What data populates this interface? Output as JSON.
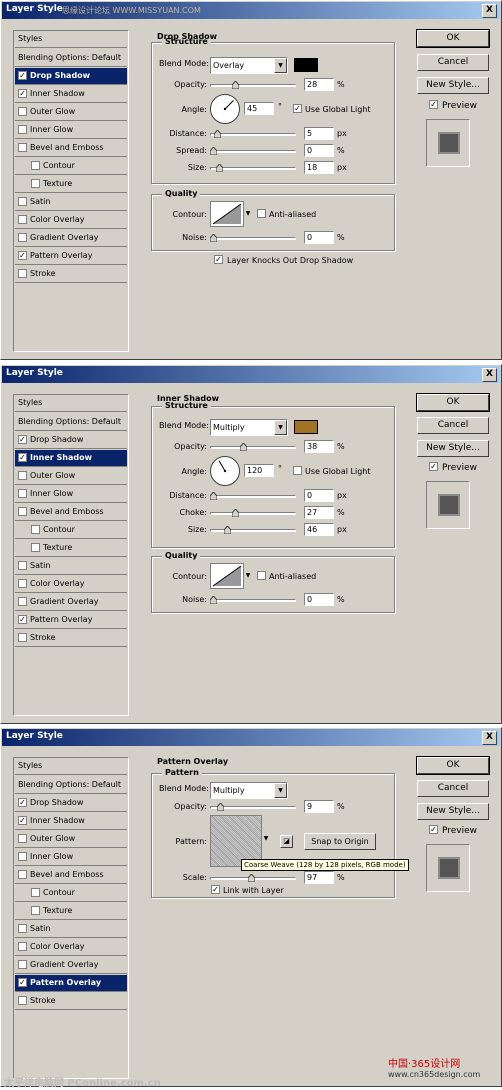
{
  "dialog_title": "Layer Style",
  "close_glyph": "X",
  "buttons": {
    "ok": "OK",
    "cancel": "Cancel",
    "new_style": "New Style...",
    "preview": "Preview"
  },
  "styles_list": [
    {
      "label": "Styles",
      "checkbox": false,
      "indent": false
    },
    {
      "label": "Blending Options: Default",
      "checkbox": false,
      "indent": false
    },
    {
      "label": "Drop Shadow",
      "checkbox": true,
      "indent": false
    },
    {
      "label": "Inner Shadow",
      "checkbox": true,
      "indent": false
    },
    {
      "label": "Outer Glow",
      "checkbox": true,
      "indent": false
    },
    {
      "label": "Inner Glow",
      "checkbox": true,
      "indent": false
    },
    {
      "label": "Bevel and Emboss",
      "checkbox": true,
      "indent": false
    },
    {
      "label": "Contour",
      "checkbox": true,
      "indent": true
    },
    {
      "label": "Texture",
      "checkbox": true,
      "indent": true
    },
    {
      "label": "Satin",
      "checkbox": true,
      "indent": false
    },
    {
      "label": "Color Overlay",
      "checkbox": true,
      "indent": false
    },
    {
      "label": "Gradient Overlay",
      "checkbox": true,
      "indent": false
    },
    {
      "label": "Pattern Overlay",
      "checkbox": true,
      "indent": false
    },
    {
      "label": "Stroke",
      "checkbox": true,
      "indent": false
    }
  ],
  "checked_styles": [
    "Drop Shadow",
    "Inner Shadow",
    "Pattern Overlay"
  ],
  "check_glyph": "✓",
  "labels": {
    "structure": "Structure",
    "blend_mode": "Blend Mode:",
    "opacity": "Opacity:",
    "angle": "Angle:",
    "distance": "Distance:",
    "spread": "Spread:",
    "choke": "Choke:",
    "size": "Size:",
    "quality": "Quality",
    "contour": "Contour:",
    "noise": "Noise:",
    "anti_aliased": "Anti-aliased",
    "use_global_light": "Use Global Light",
    "pattern_group": "Pattern",
    "pattern": "Pattern:",
    "scale": "Scale:",
    "snap_to_origin": "Snap to Origin",
    "link_with_layer": "Link with Layer",
    "pct": "%",
    "px": "px",
    "deg": "°"
  },
  "panel1": {
    "selected": "Drop Shadow",
    "section_title": "Drop Shadow",
    "blend_mode": "Overlay",
    "swatch_color": "#000000",
    "opacity": "28",
    "angle": "45",
    "use_global_light": true,
    "distance": "5",
    "spread": "0",
    "size": "18",
    "anti_aliased": false,
    "noise": "0",
    "knockout_label": "Layer Knocks Out Drop Shadow",
    "knockout": true
  },
  "panel2": {
    "selected": "Inner Shadow",
    "section_title": "Inner Shadow",
    "blend_mode": "Multiply",
    "swatch_color": "#a07326",
    "opacity": "38",
    "angle": "120",
    "use_global_light": false,
    "distance": "0",
    "choke": "27",
    "size": "46",
    "anti_aliased": false,
    "noise": "0"
  },
  "panel3": {
    "selected": "Pattern Overlay",
    "section_title": "Pattern Overlay",
    "blend_mode": "Multiply",
    "opacity": "9",
    "scale": "97",
    "link_with_layer": true,
    "tooltip": "Coarse Weave (128 by 128 pixels, RGB mode)"
  },
  "slider_levels": {
    "p1": {
      "opacity": 0.28,
      "distance": 0.05,
      "spread": 0.0,
      "size": 0.07,
      "noise": 0.0
    },
    "p2": {
      "opacity": 0.38,
      "distance": 0.0,
      "choke": 0.27,
      "size": 0.18,
      "noise": 0.0
    },
    "p3": {
      "opacity": 0.09,
      "scale": 0.48
    }
  },
  "watermarks": {
    "top": "思缘设计论坛 WWW.MISSYUAN.COM",
    "bottom_left": "太平洋电脑网 PConline.com.cn",
    "bottom_right": "中国·365设计网",
    "bottom_right_url": "www.cn365design.com"
  },
  "colors": {
    "selection": "#0a246a",
    "dialog_bg": "#d4d0c8"
  }
}
